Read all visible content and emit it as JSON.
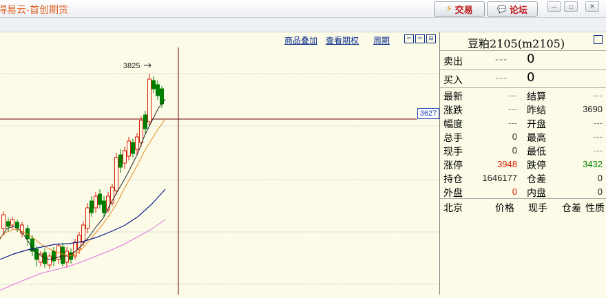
{
  "app_title": "得易云-首创期货",
  "buttons": {
    "trade": "交易",
    "forum": "论坛"
  },
  "chart": {
    "links": [
      "商品叠加",
      "查看期权",
      "周期"
    ],
    "high_label": "3825",
    "cursor_price": "3627"
  },
  "panel": {
    "contract": "豆粕2105(m2105)",
    "sell_label": "卖出",
    "sell_price": "---",
    "sell_qty": "0",
    "buy_label": "买入",
    "buy_price": "---",
    "buy_qty": "0",
    "stats_left": [
      {
        "label": "最新",
        "value": "---"
      },
      {
        "label": "涨跌",
        "value": "---"
      },
      {
        "label": "幅度",
        "value": "---"
      },
      {
        "label": "总手",
        "value": "0"
      },
      {
        "label": "现手",
        "value": "0"
      },
      {
        "label": "涨停",
        "value": "3948"
      },
      {
        "label": "持仓",
        "value": "1646177"
      },
      {
        "label": "外盘",
        "value": "0"
      }
    ],
    "stats_right": [
      {
        "label": "结算",
        "value": "---"
      },
      {
        "label": "昨结",
        "value": "3690"
      },
      {
        "label": "开盘",
        "value": "---"
      },
      {
        "label": "最高",
        "value": "---"
      },
      {
        "label": "最低",
        "value": "---"
      },
      {
        "label": "跌停",
        "value": "3432"
      },
      {
        "label": "仓差",
        "value": "0"
      },
      {
        "label": "内盘",
        "value": "0"
      }
    ],
    "trades_header": [
      "北京",
      "价格",
      "现手",
      "仓差",
      "性质"
    ]
  },
  "colors": {
    "up": "#d81e06",
    "down": "#008000",
    "accent": "#e0662a"
  }
}
